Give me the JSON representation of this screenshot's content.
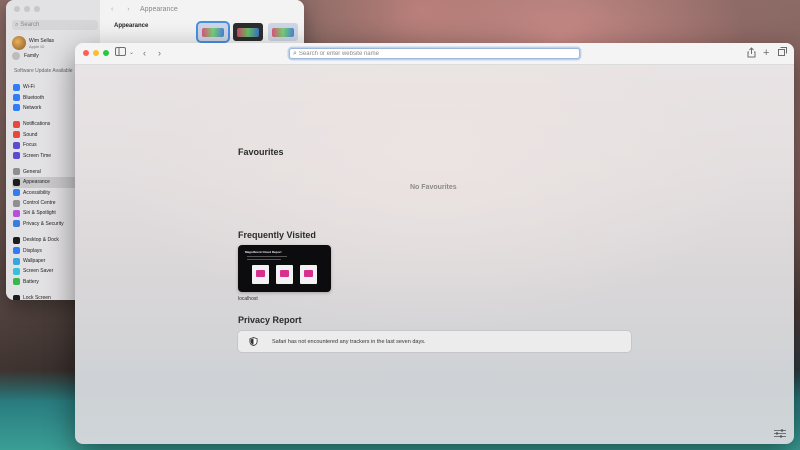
{
  "settings": {
    "search_placeholder": "Search",
    "user_name": "Wim Sellas",
    "user_sub": "Apple ID",
    "family": "Family",
    "update_text": "Software Update Available",
    "title": "Appearance",
    "section_label": "Appearance",
    "sidebar_items": [
      {
        "label": "Wi-Fi",
        "color": "#2f7cf6"
      },
      {
        "label": "Bluetooth",
        "color": "#2f7cf6"
      },
      {
        "label": "Network",
        "color": "#2f7cf6"
      },
      {
        "label": "Notifications",
        "color": "#e9463f",
        "gap": true
      },
      {
        "label": "Sound",
        "color": "#e9463f"
      },
      {
        "label": "Focus",
        "color": "#5b4bd0"
      },
      {
        "label": "Screen Time",
        "color": "#5b4bd0"
      },
      {
        "label": "General",
        "color": "#8e8e93",
        "gap": true
      },
      {
        "label": "Appearance",
        "color": "#1c1c1e",
        "active": true
      },
      {
        "label": "Accessibility",
        "color": "#2f7cf6"
      },
      {
        "label": "Control Centre",
        "color": "#8e8e93"
      },
      {
        "label": "Siri & Spotlight",
        "color": "#b84fd6"
      },
      {
        "label": "Privacy & Security",
        "color": "#3a7be0"
      },
      {
        "label": "Desktop & Dock",
        "color": "#1c1c1e",
        "gap": true
      },
      {
        "label": "Displays",
        "color": "#2f7cf6"
      },
      {
        "label": "Wallpaper",
        "color": "#39a6d9"
      },
      {
        "label": "Screen Saver",
        "color": "#39c0d9"
      },
      {
        "label": "Battery",
        "color": "#3cb54a"
      },
      {
        "label": "Lock Screen",
        "color": "#1c1c1e",
        "gap": true
      }
    ]
  },
  "safari": {
    "url_placeholder": "Search or enter website name",
    "favourites_title": "Favourites",
    "no_favourites": "No Favourites",
    "frequently_visited_title": "Frequently Visited",
    "frequent_site": {
      "label": "localhost",
      "preview_title": "Magnificent Cloud Report"
    },
    "privacy_title": "Privacy Report",
    "privacy_text": "Safari has not encountered any trackers in the last seven days."
  }
}
